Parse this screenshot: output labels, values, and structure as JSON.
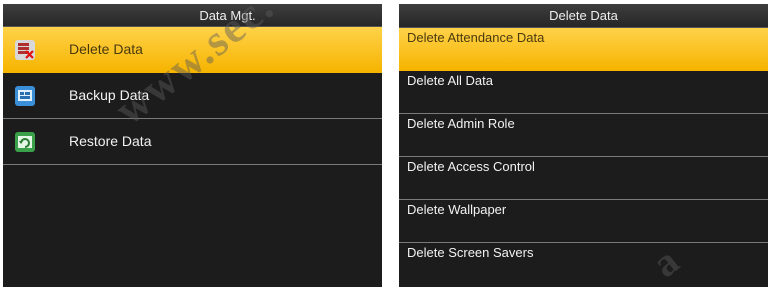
{
  "left_panel": {
    "title": "Data Mgt.",
    "items": [
      {
        "label": "Delete Data",
        "icon": "delete-data-icon",
        "selected": true
      },
      {
        "label": "Backup Data",
        "icon": "backup-data-icon",
        "selected": false
      },
      {
        "label": "Restore Data",
        "icon": "restore-data-icon",
        "selected": false
      }
    ]
  },
  "right_panel": {
    "title": "Delete Data",
    "items": [
      {
        "label": "Delete Attendance Data",
        "selected": true
      },
      {
        "label": "Delete All Data",
        "selected": false
      },
      {
        "label": "Delete Admin Role",
        "selected": false
      },
      {
        "label": "Delete Access Control",
        "selected": false
      },
      {
        "label": "Delete Wallpaper",
        "selected": false
      },
      {
        "label": "Delete Screen Savers",
        "selected": false
      }
    ]
  },
  "watermark": {
    "text": "www.sec.",
    "text_right": "a"
  },
  "colors": {
    "highlight": "#f6b400",
    "background": "#1c1c1c",
    "text": "#f2f2f2"
  }
}
